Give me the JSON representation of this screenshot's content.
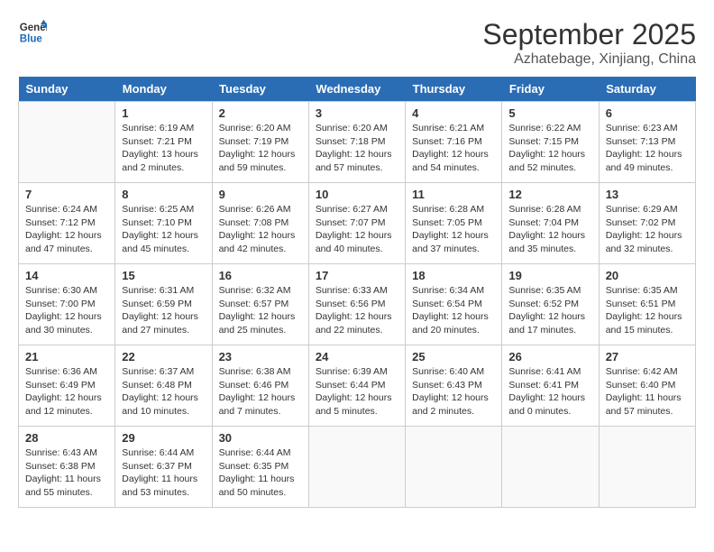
{
  "logo": {
    "line1": "General",
    "line2": "Blue"
  },
  "title": "September 2025",
  "subtitle": "Azhatebage, Xinjiang, China",
  "days_of_week": [
    "Sunday",
    "Monday",
    "Tuesday",
    "Wednesday",
    "Thursday",
    "Friday",
    "Saturday"
  ],
  "weeks": [
    [
      {
        "day": "",
        "info": ""
      },
      {
        "day": "1",
        "info": "Sunrise: 6:19 AM\nSunset: 7:21 PM\nDaylight: 13 hours\nand 2 minutes."
      },
      {
        "day": "2",
        "info": "Sunrise: 6:20 AM\nSunset: 7:19 PM\nDaylight: 12 hours\nand 59 minutes."
      },
      {
        "day": "3",
        "info": "Sunrise: 6:20 AM\nSunset: 7:18 PM\nDaylight: 12 hours\nand 57 minutes."
      },
      {
        "day": "4",
        "info": "Sunrise: 6:21 AM\nSunset: 7:16 PM\nDaylight: 12 hours\nand 54 minutes."
      },
      {
        "day": "5",
        "info": "Sunrise: 6:22 AM\nSunset: 7:15 PM\nDaylight: 12 hours\nand 52 minutes."
      },
      {
        "day": "6",
        "info": "Sunrise: 6:23 AM\nSunset: 7:13 PM\nDaylight: 12 hours\nand 49 minutes."
      }
    ],
    [
      {
        "day": "7",
        "info": "Sunrise: 6:24 AM\nSunset: 7:12 PM\nDaylight: 12 hours\nand 47 minutes."
      },
      {
        "day": "8",
        "info": "Sunrise: 6:25 AM\nSunset: 7:10 PM\nDaylight: 12 hours\nand 45 minutes."
      },
      {
        "day": "9",
        "info": "Sunrise: 6:26 AM\nSunset: 7:08 PM\nDaylight: 12 hours\nand 42 minutes."
      },
      {
        "day": "10",
        "info": "Sunrise: 6:27 AM\nSunset: 7:07 PM\nDaylight: 12 hours\nand 40 minutes."
      },
      {
        "day": "11",
        "info": "Sunrise: 6:28 AM\nSunset: 7:05 PM\nDaylight: 12 hours\nand 37 minutes."
      },
      {
        "day": "12",
        "info": "Sunrise: 6:28 AM\nSunset: 7:04 PM\nDaylight: 12 hours\nand 35 minutes."
      },
      {
        "day": "13",
        "info": "Sunrise: 6:29 AM\nSunset: 7:02 PM\nDaylight: 12 hours\nand 32 minutes."
      }
    ],
    [
      {
        "day": "14",
        "info": "Sunrise: 6:30 AM\nSunset: 7:00 PM\nDaylight: 12 hours\nand 30 minutes."
      },
      {
        "day": "15",
        "info": "Sunrise: 6:31 AM\nSunset: 6:59 PM\nDaylight: 12 hours\nand 27 minutes."
      },
      {
        "day": "16",
        "info": "Sunrise: 6:32 AM\nSunset: 6:57 PM\nDaylight: 12 hours\nand 25 minutes."
      },
      {
        "day": "17",
        "info": "Sunrise: 6:33 AM\nSunset: 6:56 PM\nDaylight: 12 hours\nand 22 minutes."
      },
      {
        "day": "18",
        "info": "Sunrise: 6:34 AM\nSunset: 6:54 PM\nDaylight: 12 hours\nand 20 minutes."
      },
      {
        "day": "19",
        "info": "Sunrise: 6:35 AM\nSunset: 6:52 PM\nDaylight: 12 hours\nand 17 minutes."
      },
      {
        "day": "20",
        "info": "Sunrise: 6:35 AM\nSunset: 6:51 PM\nDaylight: 12 hours\nand 15 minutes."
      }
    ],
    [
      {
        "day": "21",
        "info": "Sunrise: 6:36 AM\nSunset: 6:49 PM\nDaylight: 12 hours\nand 12 minutes."
      },
      {
        "day": "22",
        "info": "Sunrise: 6:37 AM\nSunset: 6:48 PM\nDaylight: 12 hours\nand 10 minutes."
      },
      {
        "day": "23",
        "info": "Sunrise: 6:38 AM\nSunset: 6:46 PM\nDaylight: 12 hours\nand 7 minutes."
      },
      {
        "day": "24",
        "info": "Sunrise: 6:39 AM\nSunset: 6:44 PM\nDaylight: 12 hours\nand 5 minutes."
      },
      {
        "day": "25",
        "info": "Sunrise: 6:40 AM\nSunset: 6:43 PM\nDaylight: 12 hours\nand 2 minutes."
      },
      {
        "day": "26",
        "info": "Sunrise: 6:41 AM\nSunset: 6:41 PM\nDaylight: 12 hours\nand 0 minutes."
      },
      {
        "day": "27",
        "info": "Sunrise: 6:42 AM\nSunset: 6:40 PM\nDaylight: 11 hours\nand 57 minutes."
      }
    ],
    [
      {
        "day": "28",
        "info": "Sunrise: 6:43 AM\nSunset: 6:38 PM\nDaylight: 11 hours\nand 55 minutes."
      },
      {
        "day": "29",
        "info": "Sunrise: 6:44 AM\nSunset: 6:37 PM\nDaylight: 11 hours\nand 53 minutes."
      },
      {
        "day": "30",
        "info": "Sunrise: 6:44 AM\nSunset: 6:35 PM\nDaylight: 11 hours\nand 50 minutes."
      },
      {
        "day": "",
        "info": ""
      },
      {
        "day": "",
        "info": ""
      },
      {
        "day": "",
        "info": ""
      },
      {
        "day": "",
        "info": ""
      }
    ]
  ]
}
